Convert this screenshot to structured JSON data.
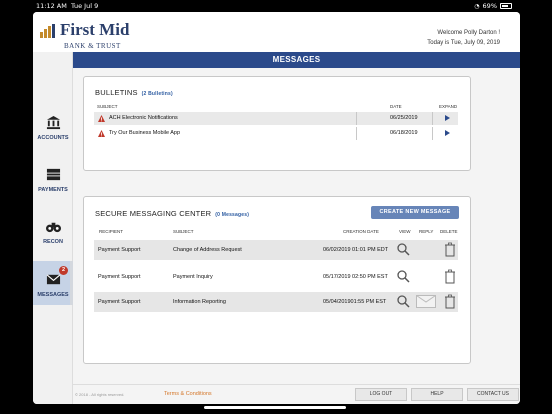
{
  "status_bar": {
    "time": "11:12 AM",
    "date": "Tue Jul 9",
    "battery": "69%"
  },
  "header": {
    "bank_name": "First Mid",
    "bank_sub": "BANK & TRUST",
    "welcome": "Welcome Polly Darton !",
    "today": "Today is Tue, July 09, 2019"
  },
  "sidebar": {
    "items": [
      {
        "label": "ACCOUNTS",
        "icon": "bank-icon"
      },
      {
        "label": "PAYMENTS",
        "icon": "payments-icon"
      },
      {
        "label": "RECON",
        "icon": "binoculars-icon"
      },
      {
        "label": "MESSAGES",
        "icon": "envelope-icon",
        "badge": "2",
        "active": true
      }
    ]
  },
  "title": "MESSAGES",
  "bulletins": {
    "title": "BULLETINS",
    "count": "(2 Bulletins)",
    "headers": {
      "subject": "SUBJECT",
      "date": "DATE",
      "expand": "EXPAND"
    },
    "rows": [
      {
        "subject": "ACH Electronic Notifications",
        "date": "06/25/2019"
      },
      {
        "subject": "Try Our Business Mobile App",
        "date": "06/18/2019"
      }
    ]
  },
  "secure": {
    "title": "SECURE MESSAGING CENTER",
    "count": "(0 Messages)",
    "new_button": "CREATE NEW MESSAGE",
    "headers": {
      "recipient": "RECIPIENT",
      "subject": "SUBJECT",
      "created": "CREATION DATE",
      "view": "VIEW",
      "reply": "REPLY",
      "delete": "DELETE"
    },
    "rows": [
      {
        "recipient": "Payment Support",
        "subject": "Change of Address Request",
        "created": "06/02/2019  01:01 PM EDT"
      },
      {
        "recipient": "Payment Support",
        "subject": "Payment Inquiry",
        "created": "05/17/2019  02:50 PM EST"
      },
      {
        "recipient": "Payment Support",
        "subject": "Information Reporting",
        "created": "05/04/201901:55 PM EST"
      }
    ]
  },
  "footer": {
    "copyright": "© 2018 - All rights reserved.",
    "terms": "Terms & Conditions",
    "logout": "LOG OUT",
    "help": "HELP",
    "contact": "CONTACT US"
  },
  "colors": {
    "brand": "#2b4a8b",
    "accent": "#c48a2a",
    "alert": "#c0392b"
  }
}
